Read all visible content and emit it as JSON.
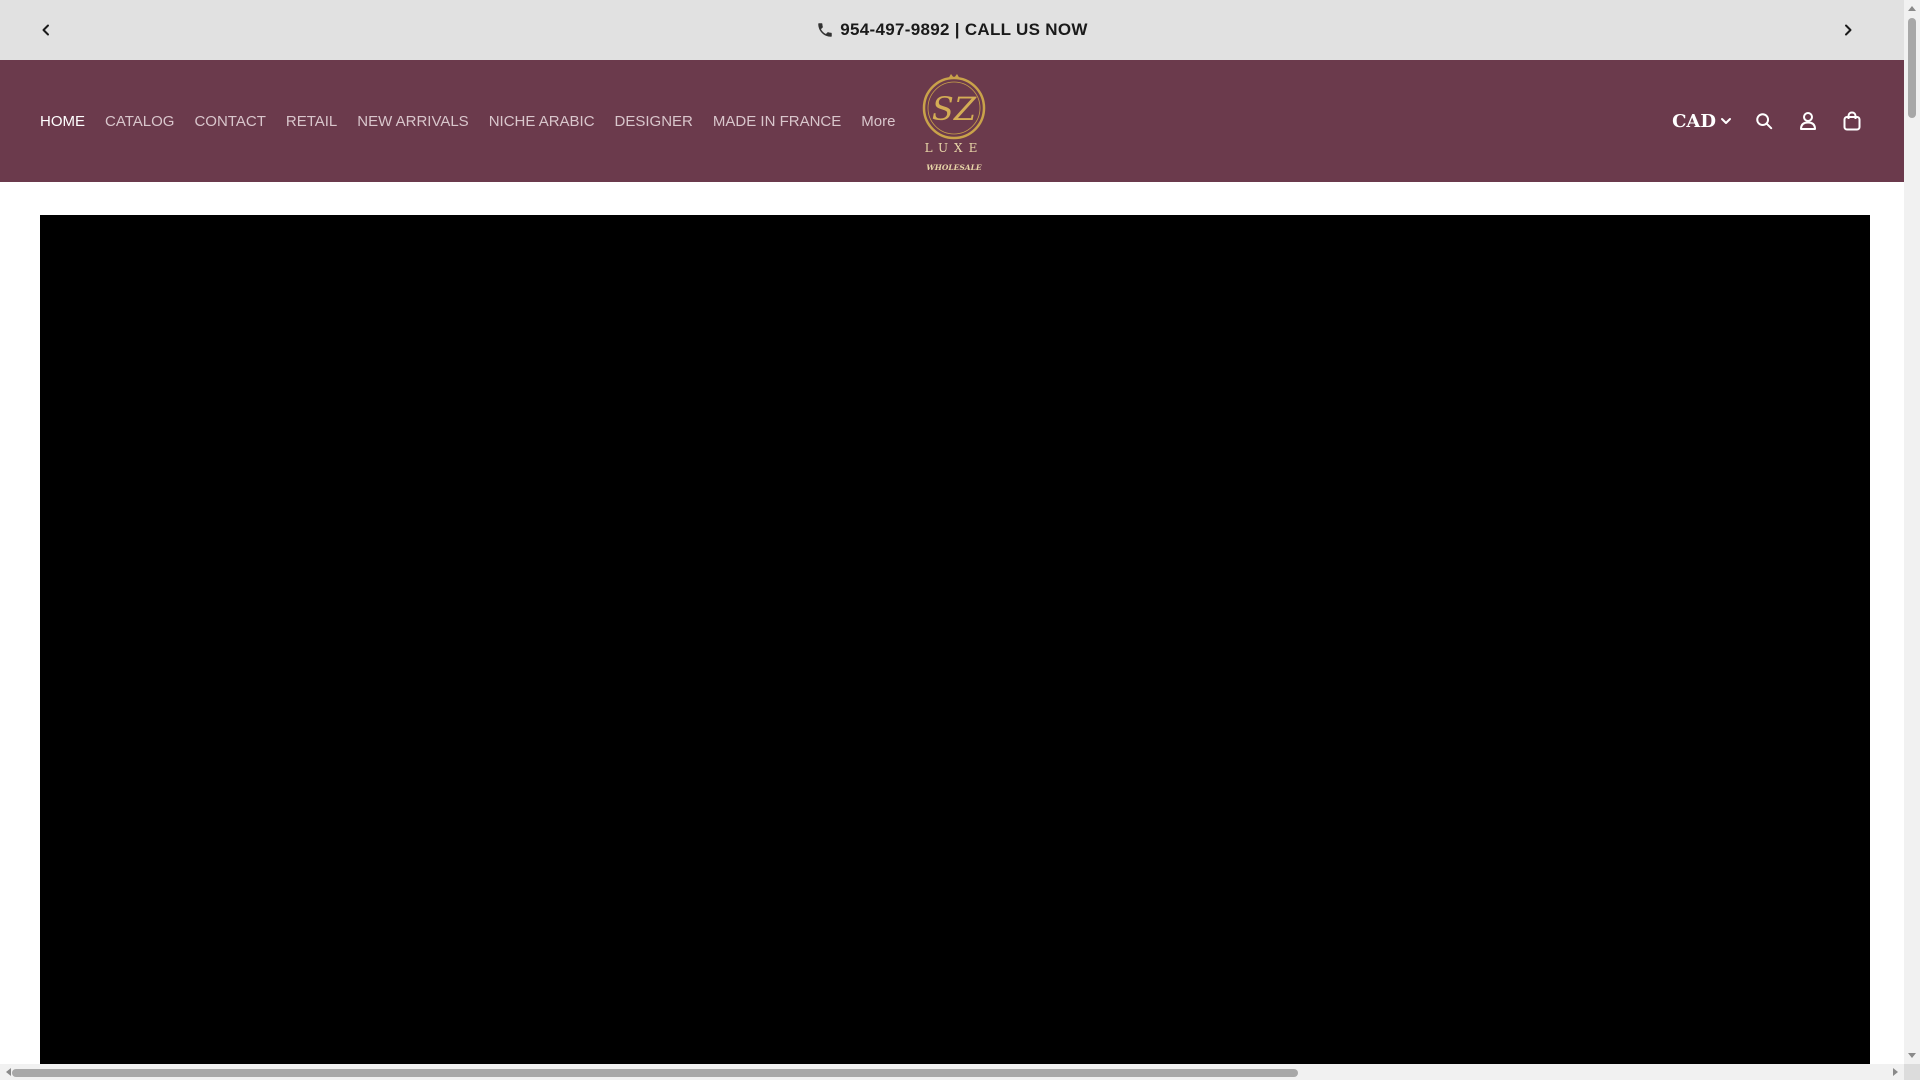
{
  "announcement": {
    "text": "954-497-9892 | CALL US NOW",
    "prev_icon": "chevron-left-icon",
    "next_icon": "chevron-right-icon",
    "phone_icon": "phone-icon"
  },
  "header": {
    "nav": [
      {
        "label": "HOME",
        "active": true
      },
      {
        "label": "CATALOG"
      },
      {
        "label": "CONTACT"
      },
      {
        "label": "RETAIL"
      },
      {
        "label": "NEW ARRIVALS"
      },
      {
        "label": "NICHE ARABIC"
      },
      {
        "label": "DESIGNER"
      },
      {
        "label": "MADE IN FRANCE"
      },
      {
        "label": "More"
      }
    ],
    "logo": {
      "monogram": "SZ",
      "word": "LUXE",
      "tagline": "WHOLESALE"
    },
    "currency": "CAD",
    "icons": [
      "search-icon",
      "account-icon",
      "cart-icon"
    ]
  },
  "colors": {
    "announcement_bg": "#e1e1e1",
    "header_bg": "#6b3a4c",
    "nav_text": "#d9c6cc",
    "nav_active": "#ffffff",
    "logo_gold": "#c9a24a",
    "hero_bg": "#000000"
  }
}
